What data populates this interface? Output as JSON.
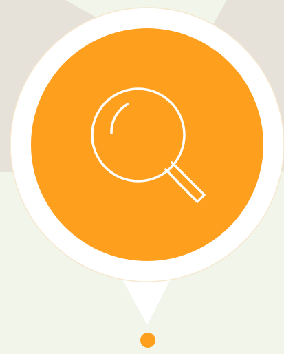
{
  "map": {
    "background_color": "#f1f5ea",
    "road_color": "#e6e1d9"
  },
  "marker": {
    "icon": "search-icon",
    "accent_color": "#ff9f1e",
    "ring_color": "#ffffff",
    "anchor_dot_color": "#ff9f1e"
  }
}
